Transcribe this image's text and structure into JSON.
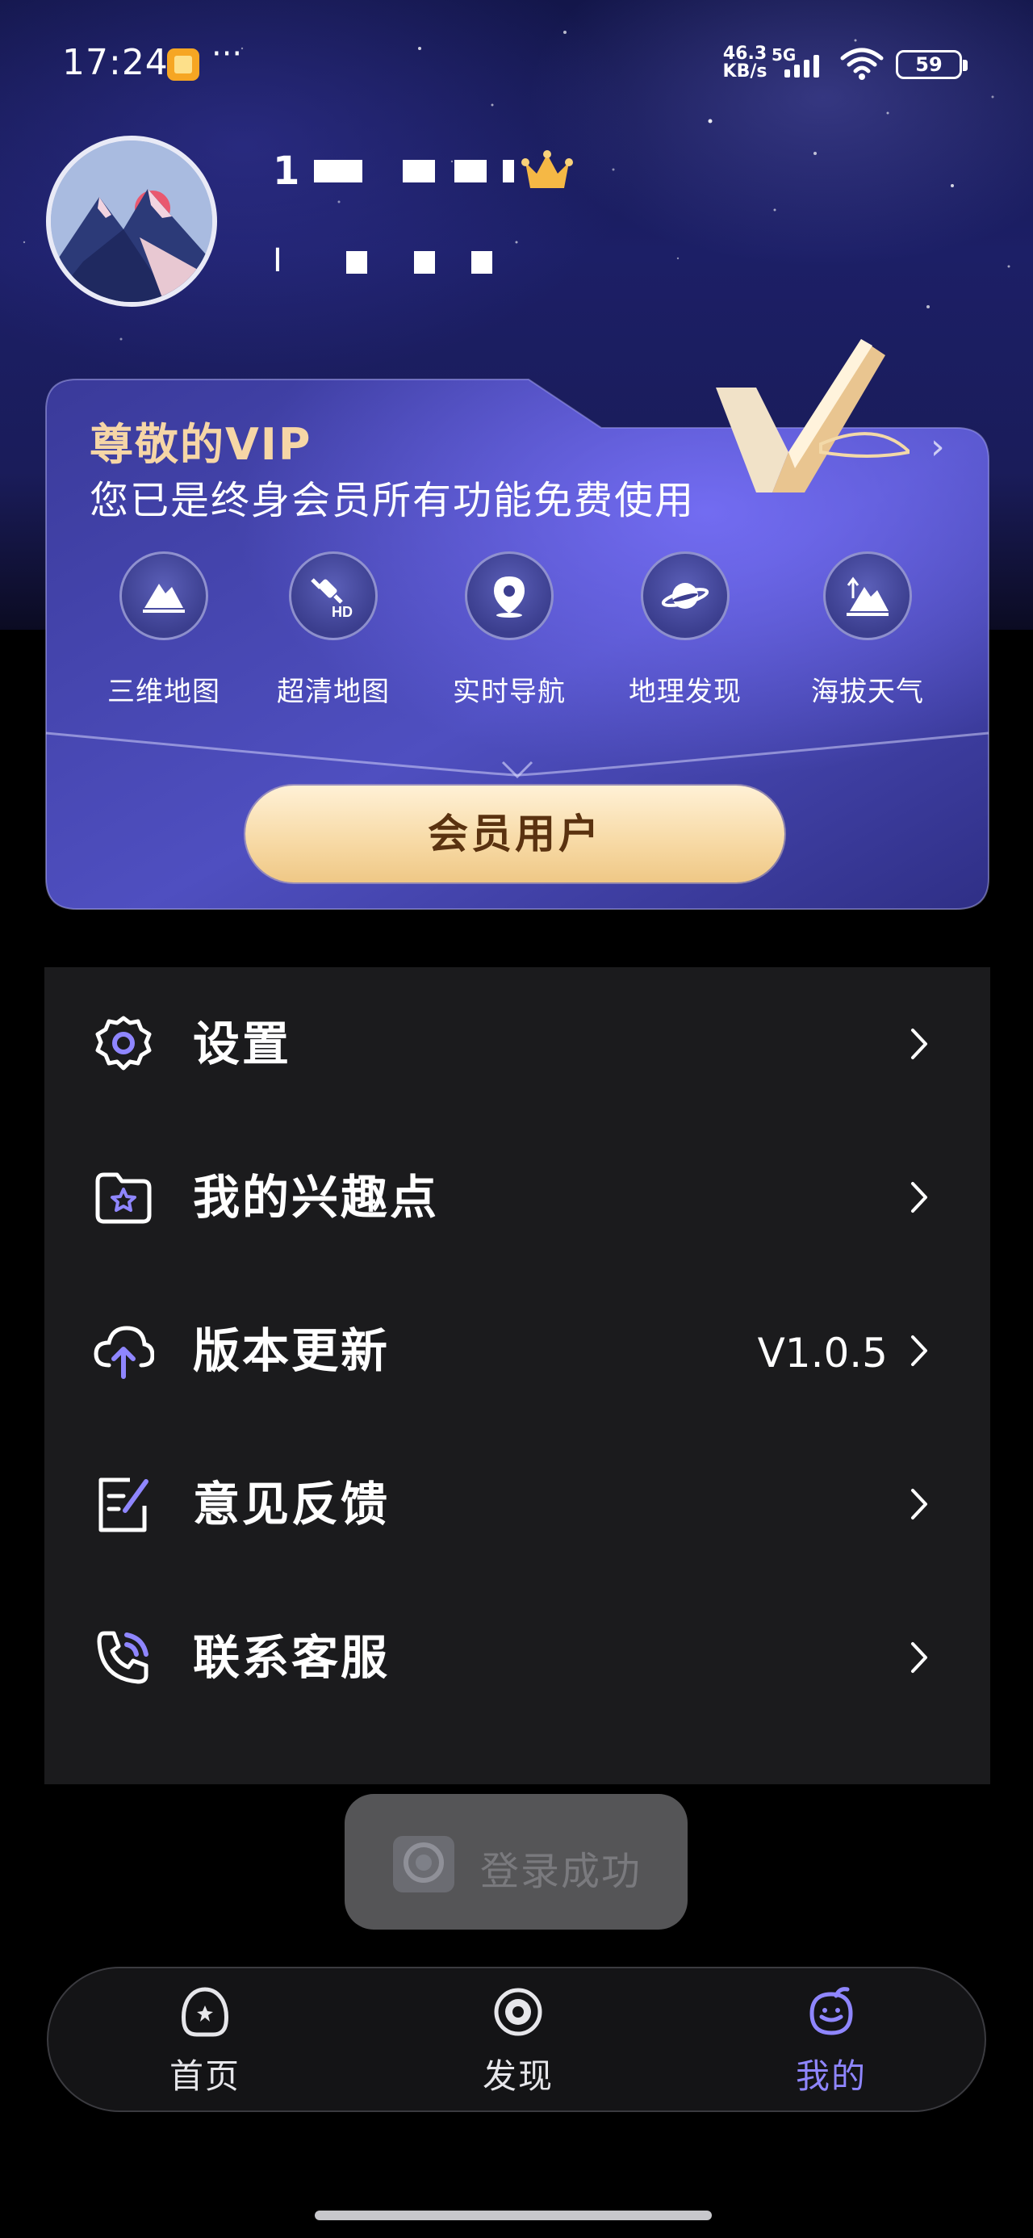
{
  "status_bar": {
    "time": "17:24",
    "more": "···",
    "net_speed_value": "46.3",
    "net_speed_unit": "KB/s",
    "net_type": "5G",
    "battery": "59"
  },
  "profile": {
    "username_visible": "1",
    "user_id_visible": "I"
  },
  "vip_card": {
    "title": "尊敬的VIP",
    "subtitle": "您已是终身会员所有功能免费使用",
    "arrow": "›",
    "features": [
      {
        "label": "三维地图",
        "icon": "mountain-3d-icon"
      },
      {
        "label": "超清地图",
        "icon": "satellite-hd-icon"
      },
      {
        "label": "实时导航",
        "icon": "location-pin-icon"
      },
      {
        "label": "地理发现",
        "icon": "planet-icon"
      },
      {
        "label": "海拔天气",
        "icon": "altitude-icon"
      }
    ],
    "button_label": "会员用户"
  },
  "menu": {
    "items": [
      {
        "label": "设置",
        "icon": "gear-icon",
        "value": ""
      },
      {
        "label": "我的兴趣点",
        "icon": "star-folder-icon",
        "value": ""
      },
      {
        "label": "版本更新",
        "icon": "cloud-upload-icon",
        "value": "V1.0.5"
      },
      {
        "label": "意见反馈",
        "icon": "feedback-edit-icon",
        "value": ""
      },
      {
        "label": "联系客服",
        "icon": "phone-icon",
        "value": ""
      }
    ]
  },
  "toast": {
    "text": "登录成功"
  },
  "tab_bar": {
    "tabs": [
      {
        "label": "首页",
        "icon": "home-icon",
        "active": false
      },
      {
        "label": "发现",
        "icon": "discover-icon",
        "active": false
      },
      {
        "label": "我的",
        "icon": "profile-icon",
        "active": true
      }
    ]
  },
  "colors": {
    "accent": "#8f86ff",
    "vip_gold": "#f6d6a6",
    "menu_bg": "#1b1b1d",
    "card_bg": "#2e2f86"
  }
}
